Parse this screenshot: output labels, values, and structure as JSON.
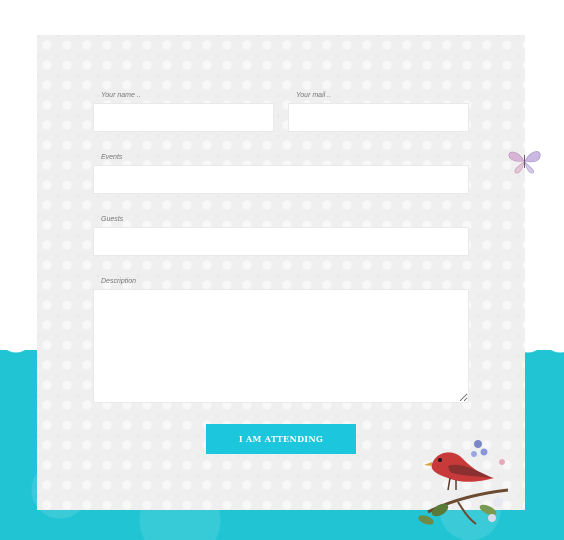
{
  "form": {
    "name_label": "Your name ..",
    "mail_label": "Your mail ..",
    "events_label": "Events",
    "guests_label": "Guests",
    "description_label": "Description",
    "name_value": "",
    "mail_value": "",
    "events_value": "",
    "guests_value": "",
    "description_value": "",
    "submit_label": "I AM ATTENDING"
  },
  "colors": {
    "accent": "#1cc6dc",
    "band": "#20c4d3",
    "card": "#efefef"
  },
  "decorations": {
    "butterfly": "butterfly-illustration",
    "bird": "bird-on-branch-illustration"
  }
}
